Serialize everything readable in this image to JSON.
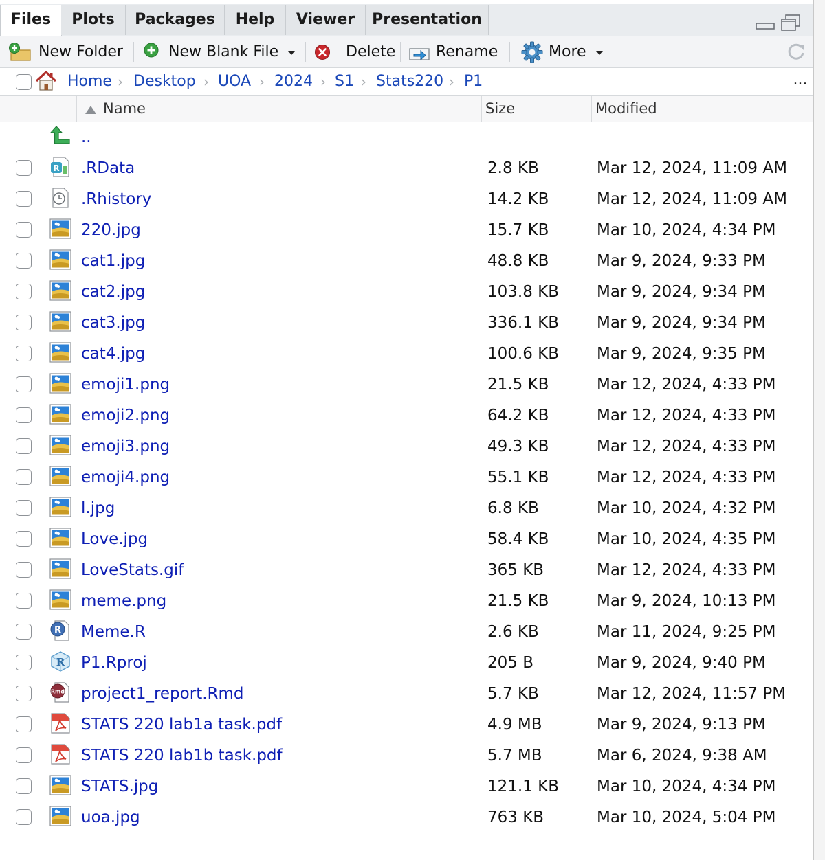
{
  "tabs": [
    "Files",
    "Plots",
    "Packages",
    "Help",
    "Viewer",
    "Presentation"
  ],
  "active_tab": "Files",
  "toolbar": {
    "new_folder": "New Folder",
    "new_blank_file": "New Blank File",
    "delete": "Delete",
    "rename": "Rename",
    "more": "More"
  },
  "breadcrumb": [
    "Home",
    "Desktop",
    "UOA",
    "2024",
    "S1",
    "Stats220",
    "P1"
  ],
  "breadcrumb_more": "...",
  "columns": {
    "name": "Name",
    "size": "Size",
    "modified": "Modified"
  },
  "parent_dir": "..",
  "files": [
    {
      "name": ".RData",
      "size": "2.8 KB",
      "modified": "Mar 12, 2024, 11:09 AM",
      "icon": "rdata-icon"
    },
    {
      "name": ".Rhistory",
      "size": "14.2 KB",
      "modified": "Mar 12, 2024, 11:09 AM",
      "icon": "history-icon"
    },
    {
      "name": "220.jpg",
      "size": "15.7 KB",
      "modified": "Mar 10, 2024, 4:34 PM",
      "icon": "image-file-icon"
    },
    {
      "name": "cat1.jpg",
      "size": "48.8 KB",
      "modified": "Mar 9, 2024, 9:33 PM",
      "icon": "image-file-icon"
    },
    {
      "name": "cat2.jpg",
      "size": "103.8 KB",
      "modified": "Mar 9, 2024, 9:34 PM",
      "icon": "image-file-icon"
    },
    {
      "name": "cat3.jpg",
      "size": "336.1 KB",
      "modified": "Mar 9, 2024, 9:34 PM",
      "icon": "image-file-icon"
    },
    {
      "name": "cat4.jpg",
      "size": "100.6 KB",
      "modified": "Mar 9, 2024, 9:35 PM",
      "icon": "image-file-icon"
    },
    {
      "name": "emoji1.png",
      "size": "21.5 KB",
      "modified": "Mar 12, 2024, 4:33 PM",
      "icon": "image-file-icon"
    },
    {
      "name": "emoji2.png",
      "size": "64.2 KB",
      "modified": "Mar 12, 2024, 4:33 PM",
      "icon": "image-file-icon"
    },
    {
      "name": "emoji3.png",
      "size": "49.3 KB",
      "modified": "Mar 12, 2024, 4:33 PM",
      "icon": "image-file-icon"
    },
    {
      "name": "emoji4.png",
      "size": "55.1 KB",
      "modified": "Mar 12, 2024, 4:33 PM",
      "icon": "image-file-icon"
    },
    {
      "name": "l.jpg",
      "size": "6.8 KB",
      "modified": "Mar 10, 2024, 4:32 PM",
      "icon": "image-file-icon"
    },
    {
      "name": "Love.jpg",
      "size": "58.4 KB",
      "modified": "Mar 10, 2024, 4:35 PM",
      "icon": "image-file-icon"
    },
    {
      "name": "LoveStats.gif",
      "size": "365 KB",
      "modified": "Mar 12, 2024, 4:33 PM",
      "icon": "image-file-icon"
    },
    {
      "name": "meme.png",
      "size": "21.5 KB",
      "modified": "Mar 9, 2024, 10:13 PM",
      "icon": "image-file-icon"
    },
    {
      "name": "Meme.R",
      "size": "2.6 KB",
      "modified": "Mar 11, 2024, 9:25 PM",
      "icon": "r-script-icon"
    },
    {
      "name": "P1.Rproj",
      "size": "205 B",
      "modified": "Mar 9, 2024, 9:40 PM",
      "icon": "rproj-icon"
    },
    {
      "name": "project1_report.Rmd",
      "size": "5.7 KB",
      "modified": "Mar 12, 2024, 11:57 PM",
      "icon": "rmd-icon"
    },
    {
      "name": "STATS 220 lab1a task.pdf",
      "size": "4.9 MB",
      "modified": "Mar 9, 2024, 9:13 PM",
      "icon": "pdf-icon"
    },
    {
      "name": "STATS 220 lab1b task.pdf",
      "size": "5.7 MB",
      "modified": "Mar 6, 2024, 9:38 AM",
      "icon": "pdf-icon"
    },
    {
      "name": "STATS.jpg",
      "size": "121.1 KB",
      "modified": "Mar 10, 2024, 4:34 PM",
      "icon": "image-file-icon"
    },
    {
      "name": "uoa.jpg",
      "size": "763 KB",
      "modified": "Mar 10, 2024, 5:04 PM",
      "icon": "image-file-icon"
    }
  ],
  "colors": {
    "link": "#0e1fb4",
    "breadcrumb": "#1a47b8",
    "tabbar": "#e9ecef",
    "toolbar": "#f3f4f6"
  }
}
